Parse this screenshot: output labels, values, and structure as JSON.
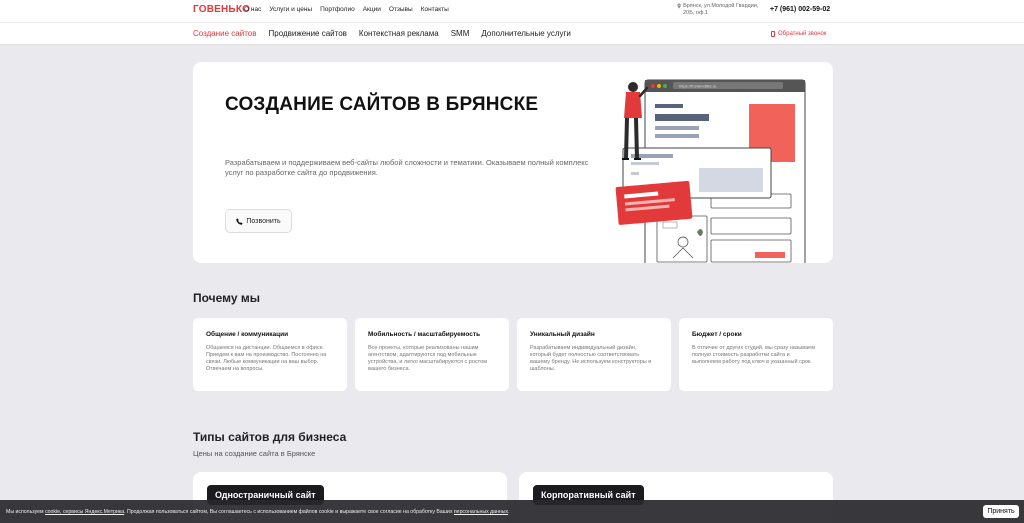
{
  "header": {
    "logo": "ГОВЕНЬКО",
    "nav": [
      "О нас",
      "Услуги и цены",
      "Портфолио",
      "Акции",
      "Отзывы",
      "Контакты"
    ],
    "address": "Брянск, ул.Молодой Гвардии, 20Б, оф.1",
    "phone": "+7 (961) 002-59-02"
  },
  "subnav": {
    "items": [
      "Создание сайтов",
      "Продвижение сайтов",
      "Контекстная реклама",
      "SMM",
      "Дополнительные услуги"
    ],
    "active_index": 0,
    "callback": "Обратный звонок"
  },
  "hero": {
    "title": "СОЗДАНИЕ САЙТОВ В БРЯНСКЕ",
    "description": "Разрабатываем и поддерживаем веб-сайты любой сложности и тематики. Оказываем полный комплекс услуг по разработке сайта до продвижения.",
    "button": "Позвонить",
    "illustration_url": "https://frontendlike.ru"
  },
  "why": {
    "title": "Почему мы",
    "cards": [
      {
        "title": "Общение / коммуникации",
        "text": "Общаемся на дистанции. Общаемся в офисе. Приедем к вам на производство. Постоянно на связи. Любые коммуникации на ваш выбор. Отвечаем на вопросы."
      },
      {
        "title": "Мобильность / масштабируемость",
        "text": "Все проекты, которые реализованы нашим агентством, адаптируются под мобильные устройства, и легко масштабируются с ростом вашего бизнеса."
      },
      {
        "title": "Уникальный дизайн",
        "text": "Разрабатываем индивидуальный дизайн, который будет полностью соответствовать вашему бренду. Не используем конструкторы и шаблоны."
      },
      {
        "title": "Бюджет / сроки",
        "text": "В отличие от других студий, мы сразу называем полную стоимость разработки сайта и выполняем работу под ключ в указанный срок."
      }
    ]
  },
  "types": {
    "title": "Типы сайтов для бизнеса",
    "subtitle": "Цены на создание сайта в Брянске",
    "cards": [
      {
        "label": "Одностраничный сайт"
      },
      {
        "label": "Корпоративный сайт"
      }
    ]
  },
  "cookie": {
    "prefix": "Мы используем",
    "link1": "cookie, сервисы Яндекс.Метрика",
    "middle": ". Продолжая пользоваться сайтом, Вы соглашаетесь с использованием файлов cookie и выражаете свое согласие на обработку Ваших",
    "link2": "персональных данных",
    "suffix": ".",
    "accept": "Принять"
  },
  "colors": {
    "accent": "#e23a3a",
    "background": "#e9e9ee",
    "dark": "#1b1b1f"
  }
}
